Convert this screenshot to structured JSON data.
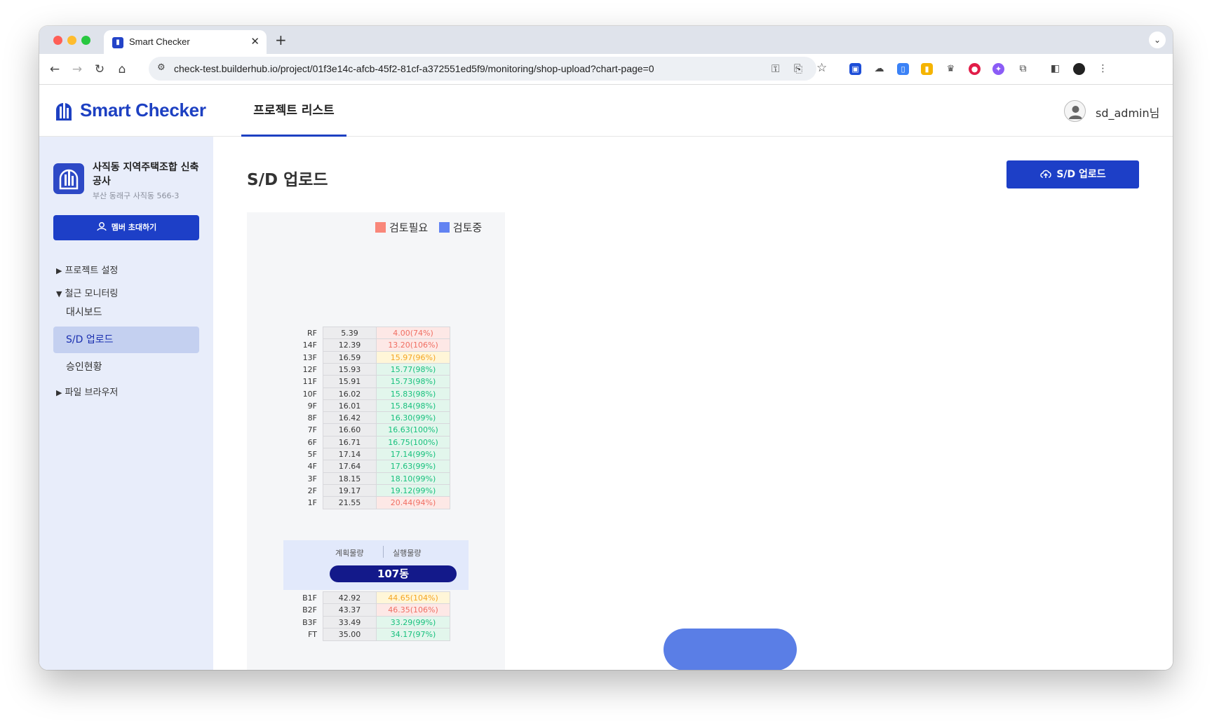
{
  "browser": {
    "tab_title": "Smart Checker",
    "tab_close": "✕",
    "new_tab": "+",
    "url": "check-test.builderhub.io/project/01f3e14c-afcb-45f2-81cf-a372551ed5f9/monitoring/shop-upload?chart-page=0"
  },
  "header": {
    "logo": "Smart Checker",
    "nav_tab": "프로젝트 리스트",
    "user": "sd_admin님"
  },
  "sidebar": {
    "project_name": "사직동 지역주택조합 신축공사",
    "project_address": "부산 동래구 사직동 566-3",
    "invite_button": "멤버 초대하기",
    "items": [
      {
        "arrow": "▶",
        "label": "프로젝트 설정"
      },
      {
        "arrow": "▼",
        "label": "철근 모니터링"
      },
      {
        "label": "대시보드"
      },
      {
        "label": "S/D 업로드",
        "active": true
      },
      {
        "label": "승인현황"
      },
      {
        "arrow": "▶",
        "label": "파일 브라우저"
      }
    ]
  },
  "main": {
    "title": "S/D 업로드",
    "upload_button": "S/D 업로드"
  },
  "colors": {
    "brand": "#1d3fc7",
    "need_review": "#f9877a",
    "reviewing": "#6283f2",
    "building_pill": "#13198a"
  },
  "chart_data": {
    "type": "table",
    "legend": [
      {
        "label": "검토필요",
        "color": "#f9877a"
      },
      {
        "label": "검토중",
        "color": "#6283f2"
      }
    ],
    "building": "107동",
    "column_headers": [
      "계획물량",
      "실행물량"
    ],
    "upper_floors": [
      {
        "floor": "RF",
        "plan": "5.39",
        "actual": "4.00(74%)",
        "status": "red"
      },
      {
        "floor": "14F",
        "plan": "12.39",
        "actual": "13.20(106%)",
        "status": "red"
      },
      {
        "floor": "13F",
        "plan": "16.59",
        "actual": "15.97(96%)",
        "status": "yellow"
      },
      {
        "floor": "12F",
        "plan": "15.93",
        "actual": "15.77(98%)",
        "status": "green"
      },
      {
        "floor": "11F",
        "plan": "15.91",
        "actual": "15.73(98%)",
        "status": "green"
      },
      {
        "floor": "10F",
        "plan": "16.02",
        "actual": "15.83(98%)",
        "status": "green"
      },
      {
        "floor": "9F",
        "plan": "16.01",
        "actual": "15.84(98%)",
        "status": "green"
      },
      {
        "floor": "8F",
        "plan": "16.42",
        "actual": "16.30(99%)",
        "status": "green"
      },
      {
        "floor": "7F",
        "plan": "16.60",
        "actual": "16.63(100%)",
        "status": "green"
      },
      {
        "floor": "6F",
        "plan": "16.71",
        "actual": "16.75(100%)",
        "status": "green"
      },
      {
        "floor": "5F",
        "plan": "17.14",
        "actual": "17.14(99%)",
        "status": "green"
      },
      {
        "floor": "4F",
        "plan": "17.64",
        "actual": "17.63(99%)",
        "status": "green"
      },
      {
        "floor": "3F",
        "plan": "18.15",
        "actual": "18.10(99%)",
        "status": "green"
      },
      {
        "floor": "2F",
        "plan": "19.17",
        "actual": "19.12(99%)",
        "status": "green"
      },
      {
        "floor": "1F",
        "plan": "21.55",
        "actual": "20.44(94%)",
        "status": "red"
      }
    ],
    "lower_floors": [
      {
        "floor": "B1F",
        "plan": "42.92",
        "actual": "44.65(104%)",
        "status": "yellow"
      },
      {
        "floor": "B2F",
        "plan": "43.37",
        "actual": "46.35(106%)",
        "status": "red"
      },
      {
        "floor": "B3F",
        "plan": "33.49",
        "actual": "33.29(99%)",
        "status": "green"
      },
      {
        "floor": "FT",
        "plan": "35.00",
        "actual": "34.17(97%)",
        "status": "green"
      }
    ]
  }
}
